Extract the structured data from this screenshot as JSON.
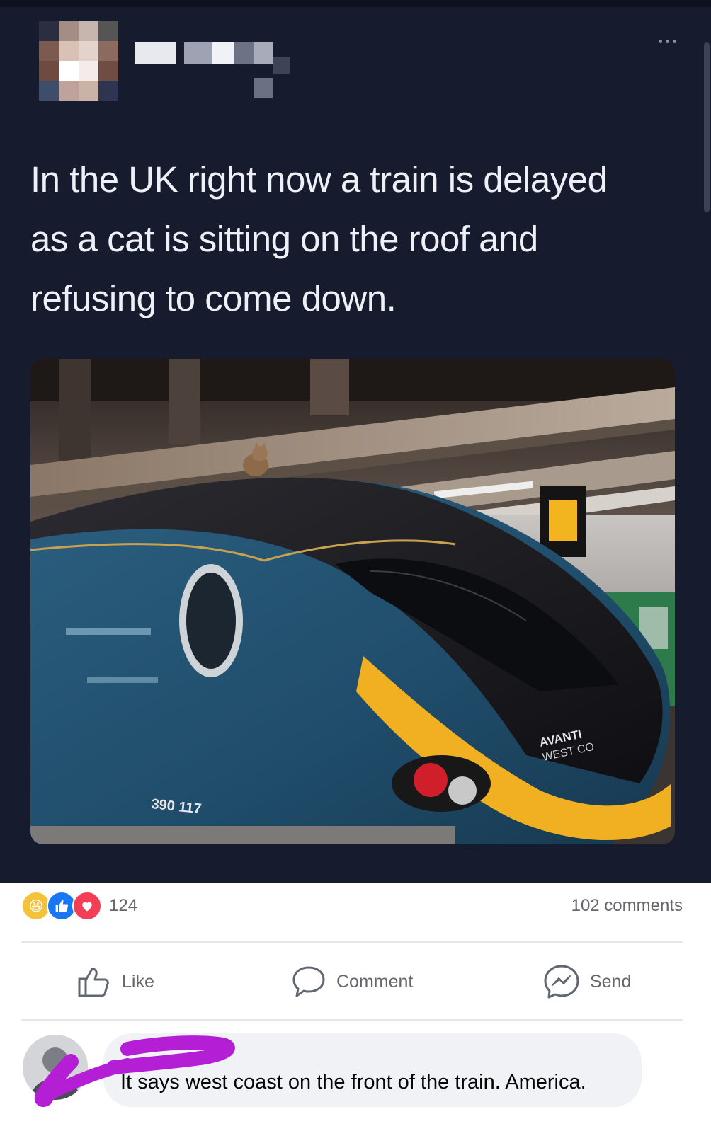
{
  "tweet": {
    "text_lines": [
      "In the UK right now a train is delayed",
      "as a cat is sitting on the roof and",
      "refusing to come down."
    ],
    "photo": {
      "train_brand_line1": "AVANTI",
      "train_brand_line2": "WEST CO",
      "train_number": "390 117"
    }
  },
  "facebook": {
    "reaction_count": "124",
    "comments_count": "102 comments",
    "actions": {
      "like": "Like",
      "comment": "Comment",
      "send": "Send"
    },
    "comment": {
      "text": "It says west coast on the front of the train. America."
    }
  },
  "colors": {
    "tweet_bg": "#171b2e",
    "facebook_gray": "#65676b",
    "like_blue": "#1877f2",
    "redaction_purple": "#b41fd6"
  }
}
